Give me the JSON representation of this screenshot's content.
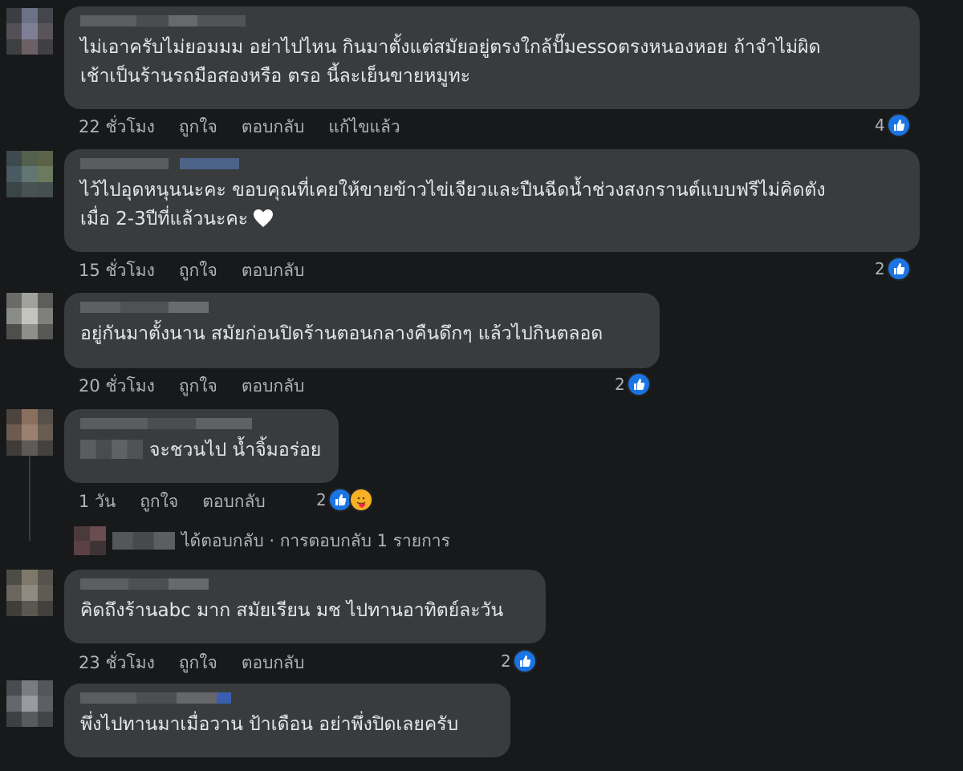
{
  "comments": [
    {
      "text_lines": [
        "ไม่เอาครับไม่ยอมมม อย่าไปไหน กินมาตั้งแต่สมัยอยู่ตรงใกล้ปั๊มessoตรงหนองหอย ถ้าจำไม่ผิด",
        "เช้าเป็นร้านรถมือสองหรือ ตรอ นี้ละเย็นขายหมูทะ"
      ],
      "time": "22 ชั่วโมง",
      "like_label": "ถูกใจ",
      "reply_label": "ตอบกลับ",
      "edited_label": "แก้ไขแล้ว",
      "reaction_count": "4"
    },
    {
      "text_lines": [
        "ไว้ไปอุดหนุนนะคะ ขอบคุณที่เคยให้ขายข้าวไข่เจียวและปืนฉีดน้ำช่วงสงกรานต์แบบฟรีไม่คิดตัง",
        "เมื่อ 2-3ปีที่แล้วนะคะ"
      ],
      "time": "15 ชั่วโมง",
      "like_label": "ถูกใจ",
      "reply_label": "ตอบกลับ",
      "reaction_count": "2"
    },
    {
      "text_lines": [
        "อยู่กันมาตั้งนาน สมัยก่อนปิดร้านตอนกลางคืนดึกๆ แล้วไปกินตลอด"
      ],
      "time": "20 ชั่วโมง",
      "like_label": "ถูกใจ",
      "reply_label": "ตอบกลับ",
      "reaction_count": "2"
    },
    {
      "text_lines": [
        "จะชวนไป น้ำจิ้มอร่อย"
      ],
      "time": "1 วัน",
      "like_label": "ถูกใจ",
      "reply_label": "ตอบกลับ",
      "reaction_count": "2",
      "reply_summary": "ได้ตอบกลับ · การตอบกลับ 1 รายการ"
    },
    {
      "text_lines": [
        "คิดถึงร้านabc มาก สมัยเรียน มช ไปทานอาทิตย์ละวัน"
      ],
      "time": "23 ชั่วโมง",
      "like_label": "ถูกใจ",
      "reply_label": "ตอบกลับ",
      "reaction_count": "2"
    },
    {
      "text_lines": [
        "พึ่งไปทานมาเมื่อวาน ป้าเดือน อย่าพึ่งปิดเลยครับ"
      ]
    }
  ],
  "colors": {
    "background": "#18191a",
    "bubble": "#3a3b3c",
    "text": "#e4e6eb",
    "secondary_text": "#b0b3b8",
    "like_blue": "#1b74e4"
  },
  "icons": [
    "like-reaction-icon",
    "care-reaction-icon",
    "white-heart-icon"
  ]
}
